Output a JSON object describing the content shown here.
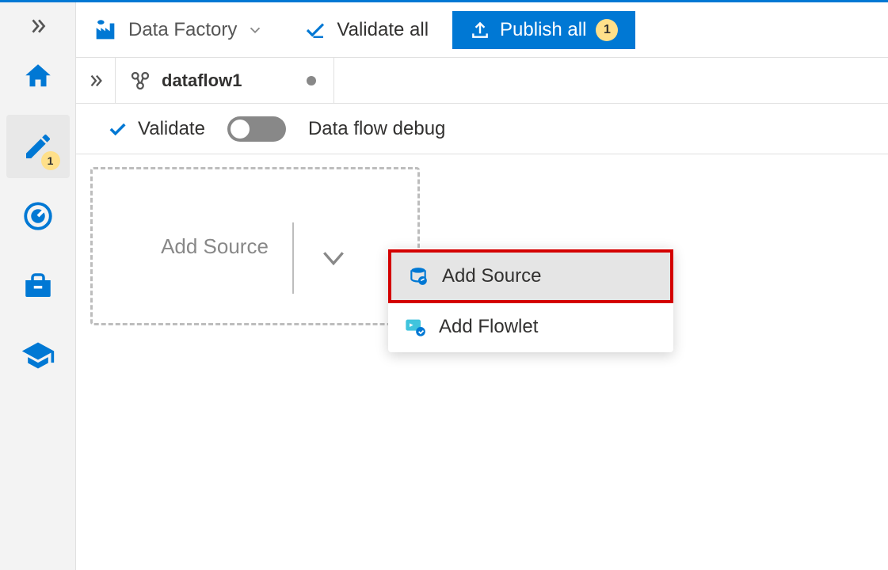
{
  "brand": {
    "label": "Data Factory"
  },
  "toolbar": {
    "validate_all": "Validate all",
    "publish": "Publish all",
    "publish_count": "1"
  },
  "rail": {
    "author_badge": "1"
  },
  "tab": {
    "title": "dataflow1"
  },
  "flow_toolbar": {
    "validate": "Validate",
    "debug_label": "Data flow debug"
  },
  "canvas": {
    "add_source": "Add Source"
  },
  "menu": {
    "add_source": "Add Source",
    "add_flowlet": "Add Flowlet"
  }
}
